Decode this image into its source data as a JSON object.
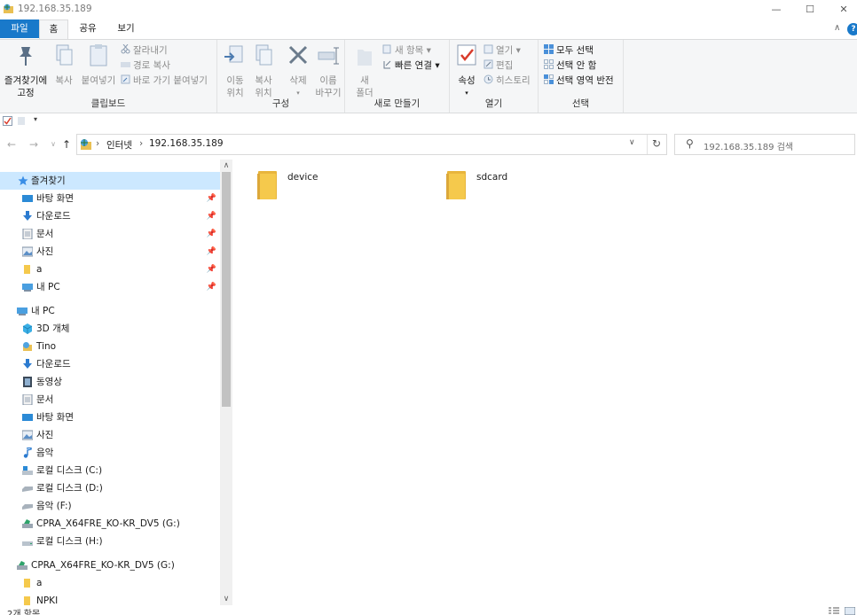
{
  "window": {
    "title": "192.168.35.189",
    "minimize": "—",
    "maximize": "☐",
    "close": "✕"
  },
  "tabs": {
    "file": "파일",
    "home": "홈",
    "share": "공유",
    "view": "보기",
    "collapse": "∧",
    "help": "?"
  },
  "ribbon": {
    "clipboard": {
      "label": "클립보드",
      "pin_line1": "즐겨찾기에",
      "pin_line2": "고정",
      "copy": "복사",
      "paste": "붙여넣기",
      "cut": "잘라내기",
      "copy_path": "경로 복사",
      "paste_shortcut": "바로 가기 붙여넣기"
    },
    "organize": {
      "label": "구성",
      "move_line1": "이동",
      "move_line2": "위치",
      "copyto_line1": "복사",
      "copyto_line2": "위치",
      "delete": "삭제",
      "rename_line1": "이름",
      "rename_line2": "바꾸기"
    },
    "new": {
      "label": "새로 만들기",
      "folder_line1": "새",
      "folder_line2": "폴더",
      "new_item": "새 항목",
      "easy_access": "빠른 연결"
    },
    "open": {
      "label": "열기",
      "properties": "속성",
      "open": "열기",
      "edit": "편집",
      "history": "히스토리"
    },
    "select": {
      "label": "선택",
      "select_all": "모두 선택",
      "select_none": "선택 안 함",
      "invert": "선택 영역 반전"
    }
  },
  "navigation": {
    "back": "←",
    "forward": "→",
    "recent": "∨",
    "up": "↑"
  },
  "address": {
    "sep": "›",
    "crumb1": "인터넷",
    "crumb2": "192.168.35.189",
    "dropdown": "∨",
    "refresh": "↻"
  },
  "search": {
    "icon": "⚲",
    "placeholder": "192.168.35.189 검색"
  },
  "sidebar": {
    "quick_access": "즐겨찾기",
    "quick_items": [
      "바탕 화면",
      "다운로드",
      "문서",
      "사진",
      "a",
      "내 PC"
    ],
    "this_pc": "내 PC",
    "pc_items": [
      "3D 개체",
      "Tino",
      "다운로드",
      "동영상",
      "문서",
      "바탕 화면",
      "사진",
      "음악",
      "로컬 디스크 (C:)",
      "로컬 디스크 (D:)",
      "음악 (F:)",
      "CPRA_X64FRE_KO-KR_DV5 (G:)",
      "로컬 디스크 (H:)"
    ],
    "drive_g": "CPRA_X64FRE_KO-KR_DV5 (G:)",
    "drive_items": [
      "a",
      "NPKI"
    ]
  },
  "content": {
    "folders": [
      "device",
      "sdcard"
    ]
  },
  "status": {
    "count": "2개 항목"
  },
  "colors": {
    "accent": "#1979ca",
    "folder": "#f5c94c",
    "selection": "#cce8ff"
  }
}
